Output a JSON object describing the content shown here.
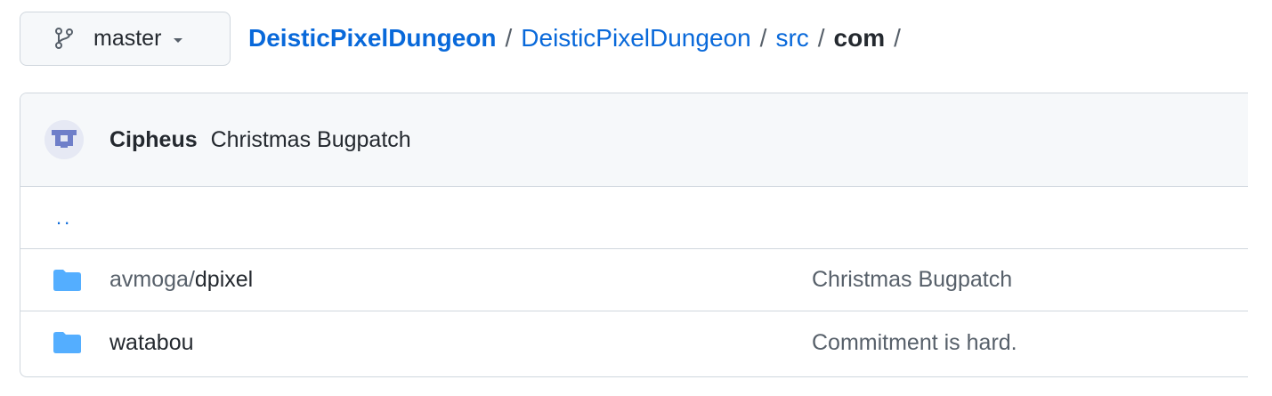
{
  "branch": {
    "icon": "git-branch-icon",
    "name": "master"
  },
  "breadcrumb": {
    "root": "DeisticPixelDungeon",
    "parts": [
      "DeisticPixelDungeon",
      "src"
    ],
    "current": "com",
    "separator": "/"
  },
  "latest_commit": {
    "author": "Cipheus",
    "message": "Christmas Bugpatch"
  },
  "parent_dir": "..",
  "files": [
    {
      "type": "folder",
      "icon": "folder-icon",
      "name_prefix": "avmoga/",
      "name": "dpixel",
      "commit_message": "Christmas Bugpatch"
    },
    {
      "type": "folder",
      "icon": "folder-icon",
      "name_prefix": "",
      "name": "watabou",
      "commit_message": "Commitment is hard."
    }
  ],
  "colors": {
    "link": "#0969da",
    "folder": "#54aeff",
    "border": "#d0d7de",
    "header_bg": "#f6f8fa"
  }
}
